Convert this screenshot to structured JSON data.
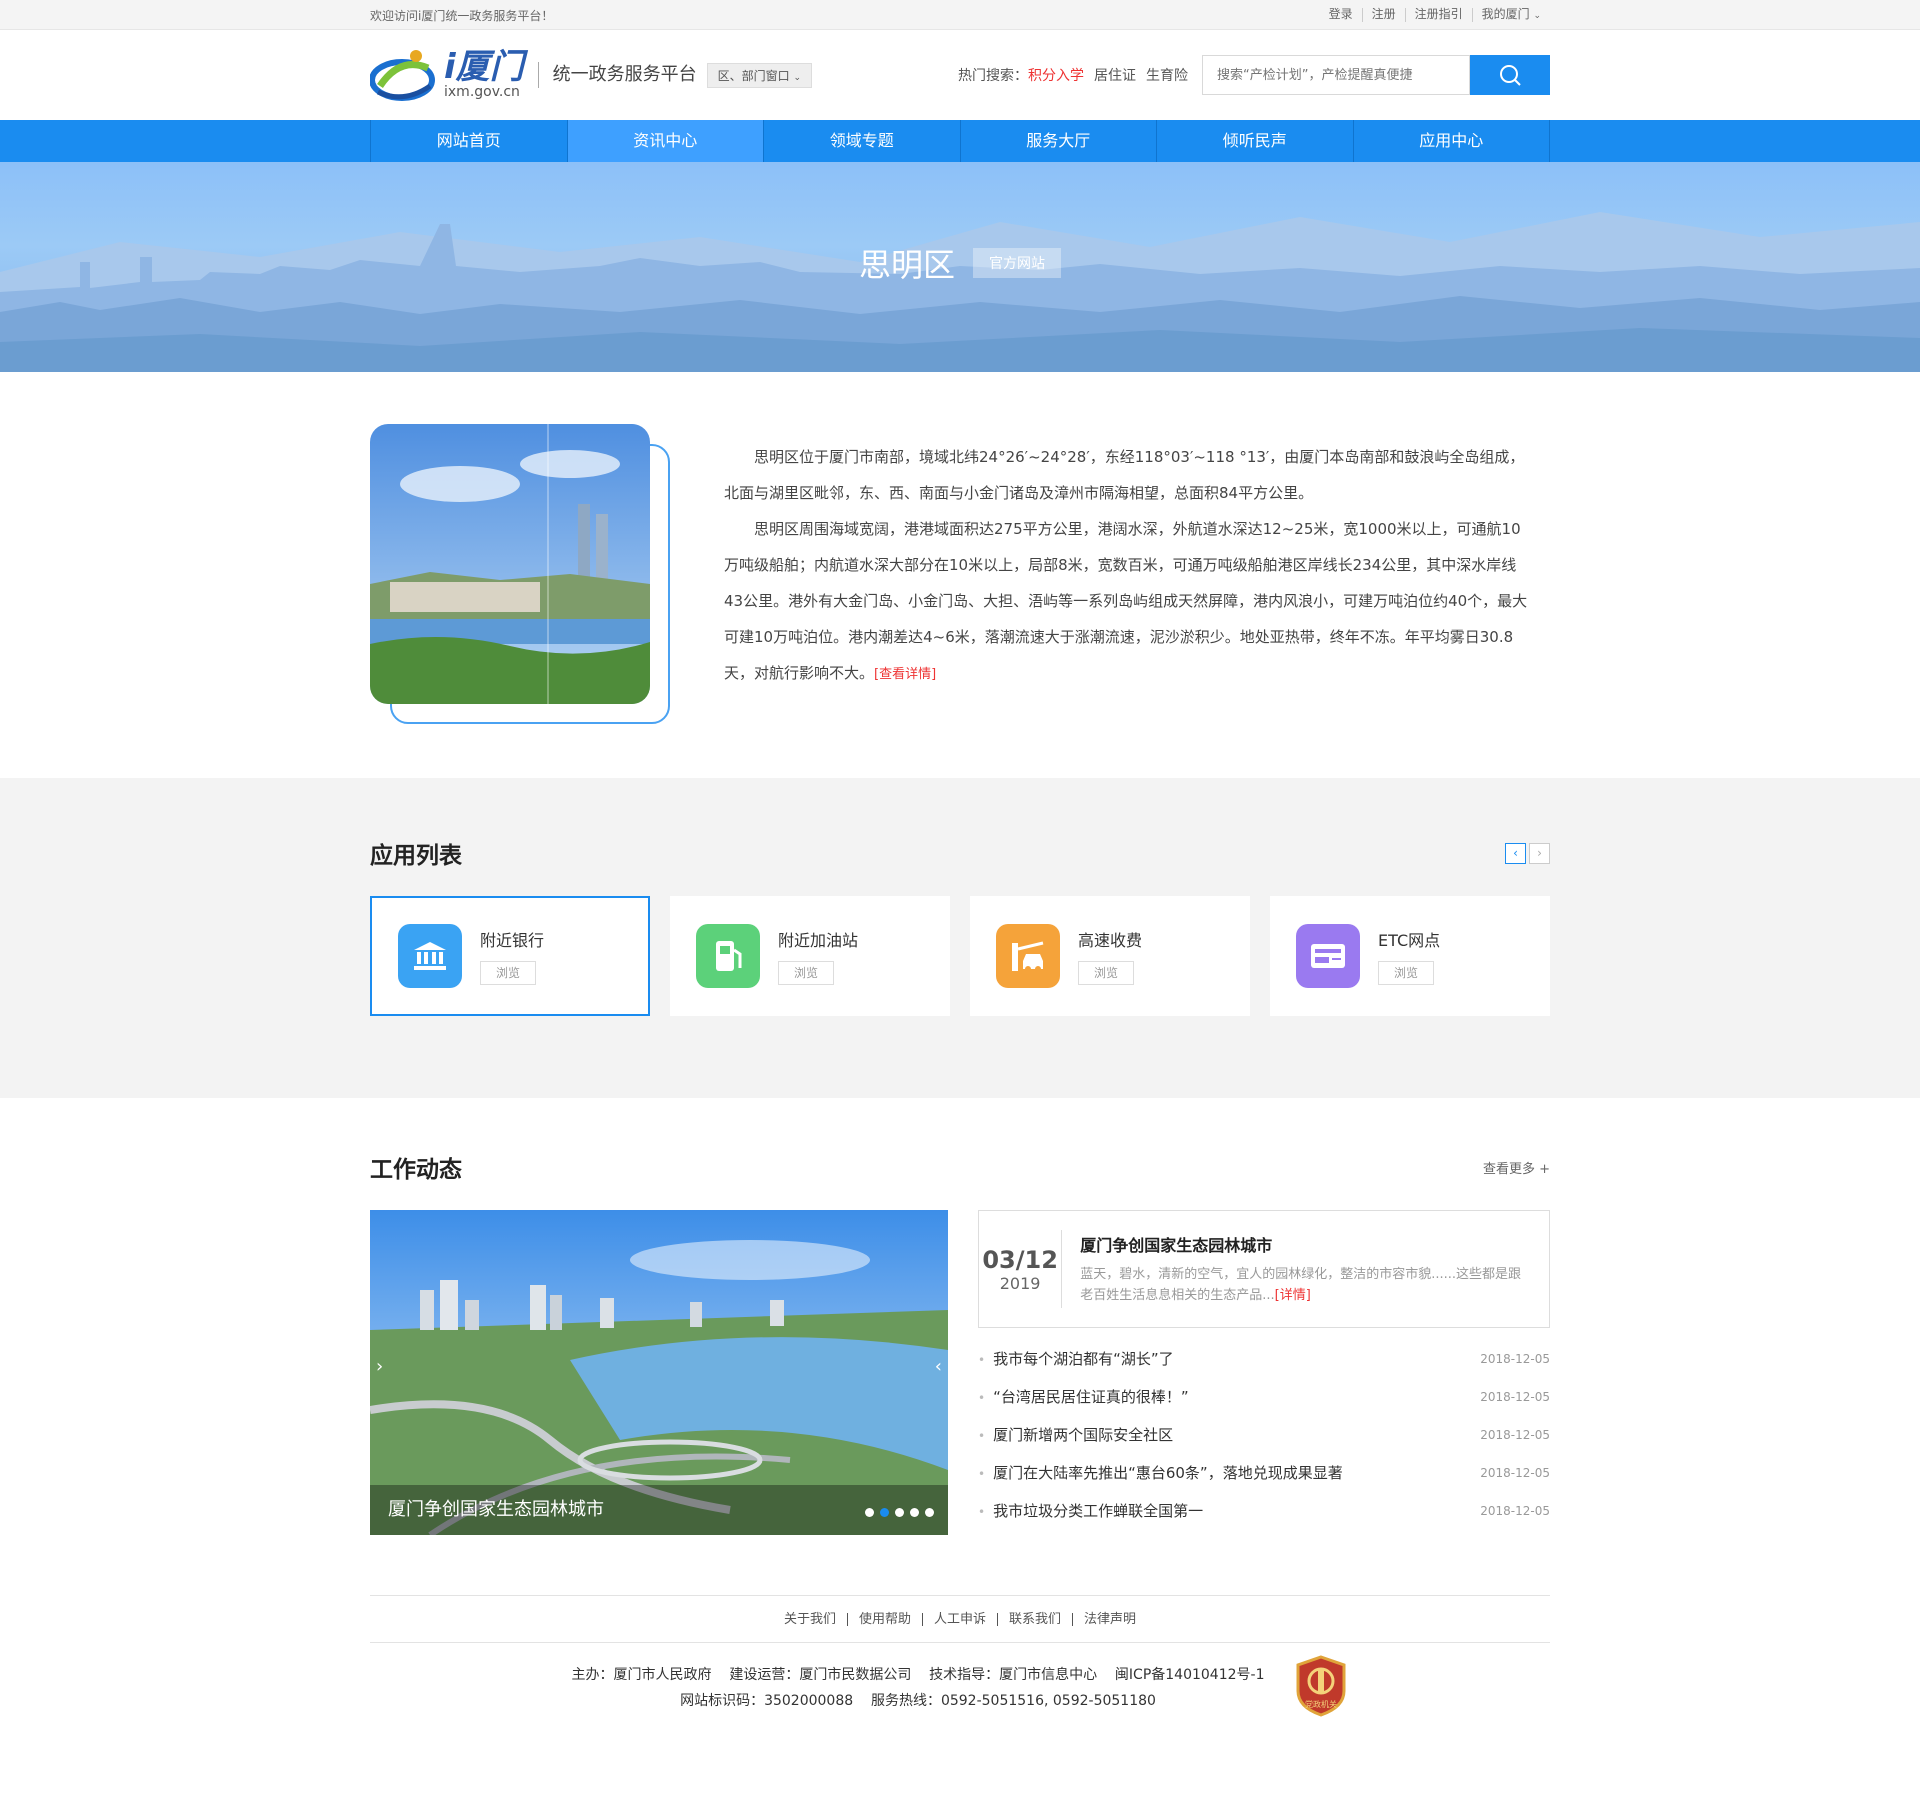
{
  "topbar": {
    "welcome": "欢迎访问i厦门统一政务服务平台！",
    "links": [
      "登录",
      "注册",
      "注册指引",
      "我的厦门"
    ]
  },
  "header": {
    "logo_text": "i厦门",
    "logo_domain": "ixm.gov.cn",
    "platform": "统一政务服务平台",
    "dept_select": "区、部门窗口",
    "hot_label": "热门搜索：",
    "hot_terms": [
      "积分入学",
      "居住证",
      "生育险"
    ],
    "search_placeholder": "搜索“产检计划”，产检提醒真便捷"
  },
  "nav": {
    "items": [
      "网站首页",
      "资讯中心",
      "领域专题",
      "服务大厅",
      "倾听民声",
      "应用中心"
    ],
    "active_index": 1
  },
  "banner": {
    "title": "思明区",
    "tag": "官方网站"
  },
  "intro": {
    "p1": "思明区位于厦门市南部，境域北纬24°26′~24°28′，东经118°03′~118 °13′，由厦门本岛南部和鼓浪屿全岛组成，北面与湖里区毗邻，东、西、南面与小金门诸岛及漳州市隔海相望，总面积84平方公里。",
    "p2": "思明区周围海域宽阔，港港域面积达275平方公里，港阔水深，外航道水深达12~25米，宽1000米以上，可通航10万吨级船舶；内航道水深大部分在10米以上，局部8米，宽数百米，可通万吨级船舶港区岸线长234公里，其中深水岸线43公里。港外有大金门岛、小金门岛、大担、浯屿等一系列岛屿组成天然屏障，港内风浪小，可建万吨泊位约40个，最大可建10万吨泊位。港内潮差达4~6米，落潮流速大于涨潮流速，泥沙淤积少。地处亚热带，终年不冻。年平均雾日30.8天，对航行影响不大。",
    "more": "[查看详情]"
  },
  "apps": {
    "title": "应用列表",
    "prev": "‹",
    "next": "›",
    "items": [
      {
        "name": "附近银行",
        "btn": "浏览",
        "icon": "bank-icon",
        "color": "#3aa3f3"
      },
      {
        "name": "附近加油站",
        "btn": "浏览",
        "icon": "gas-station-icon",
        "color": "#5cd17a"
      },
      {
        "name": "高速收费",
        "btn": "浏览",
        "icon": "toll-icon",
        "color": "#f5a33a"
      },
      {
        "name": "ETC网点",
        "btn": "浏览",
        "icon": "etc-card-icon",
        "color": "#9a7af0"
      }
    ]
  },
  "news": {
    "title": "工作动态",
    "more": "查看更多 +",
    "slide_caption": "厦门争创国家生态园林城市",
    "feature": {
      "md": "03/12",
      "year": "2019",
      "headline": "厦门争创国家生态园林城市",
      "summary": "蓝天，碧水，清新的空气，宜人的园林绿化，整洁的市容市貌......这些都是跟老百姓生活息息相关的生态产品...",
      "detail": "[详情]"
    },
    "items": [
      {
        "title": "我市每个湖泊都有“湖长”了",
        "date": "2018-12-05"
      },
      {
        "title": "“台湾居民居住证真的很棒！”",
        "date": "2018-12-05"
      },
      {
        "title": "厦门新增两个国际安全社区",
        "date": "2018-12-05"
      },
      {
        "title": "厦门在大陆率先推出“惠台60条”，落地兑现成果显著",
        "date": "2018-12-05"
      },
      {
        "title": "我市垃圾分类工作蝉联全国第一",
        "date": "2018-12-05"
      }
    ]
  },
  "footer": {
    "links": [
      "关于我们",
      "使用帮助",
      "人工申诉",
      "联系我们",
      "法律声明"
    ],
    "line1": "主办：厦门市人民政府    建设运营：厦门市民数据公司    技术指导：厦门市信息中心    闽ICP备14010412号-1",
    "line2": "网站标识码：3502000088    服务热线：0592-5051516, 0592-5051180",
    "badge_text": "党政机关"
  }
}
